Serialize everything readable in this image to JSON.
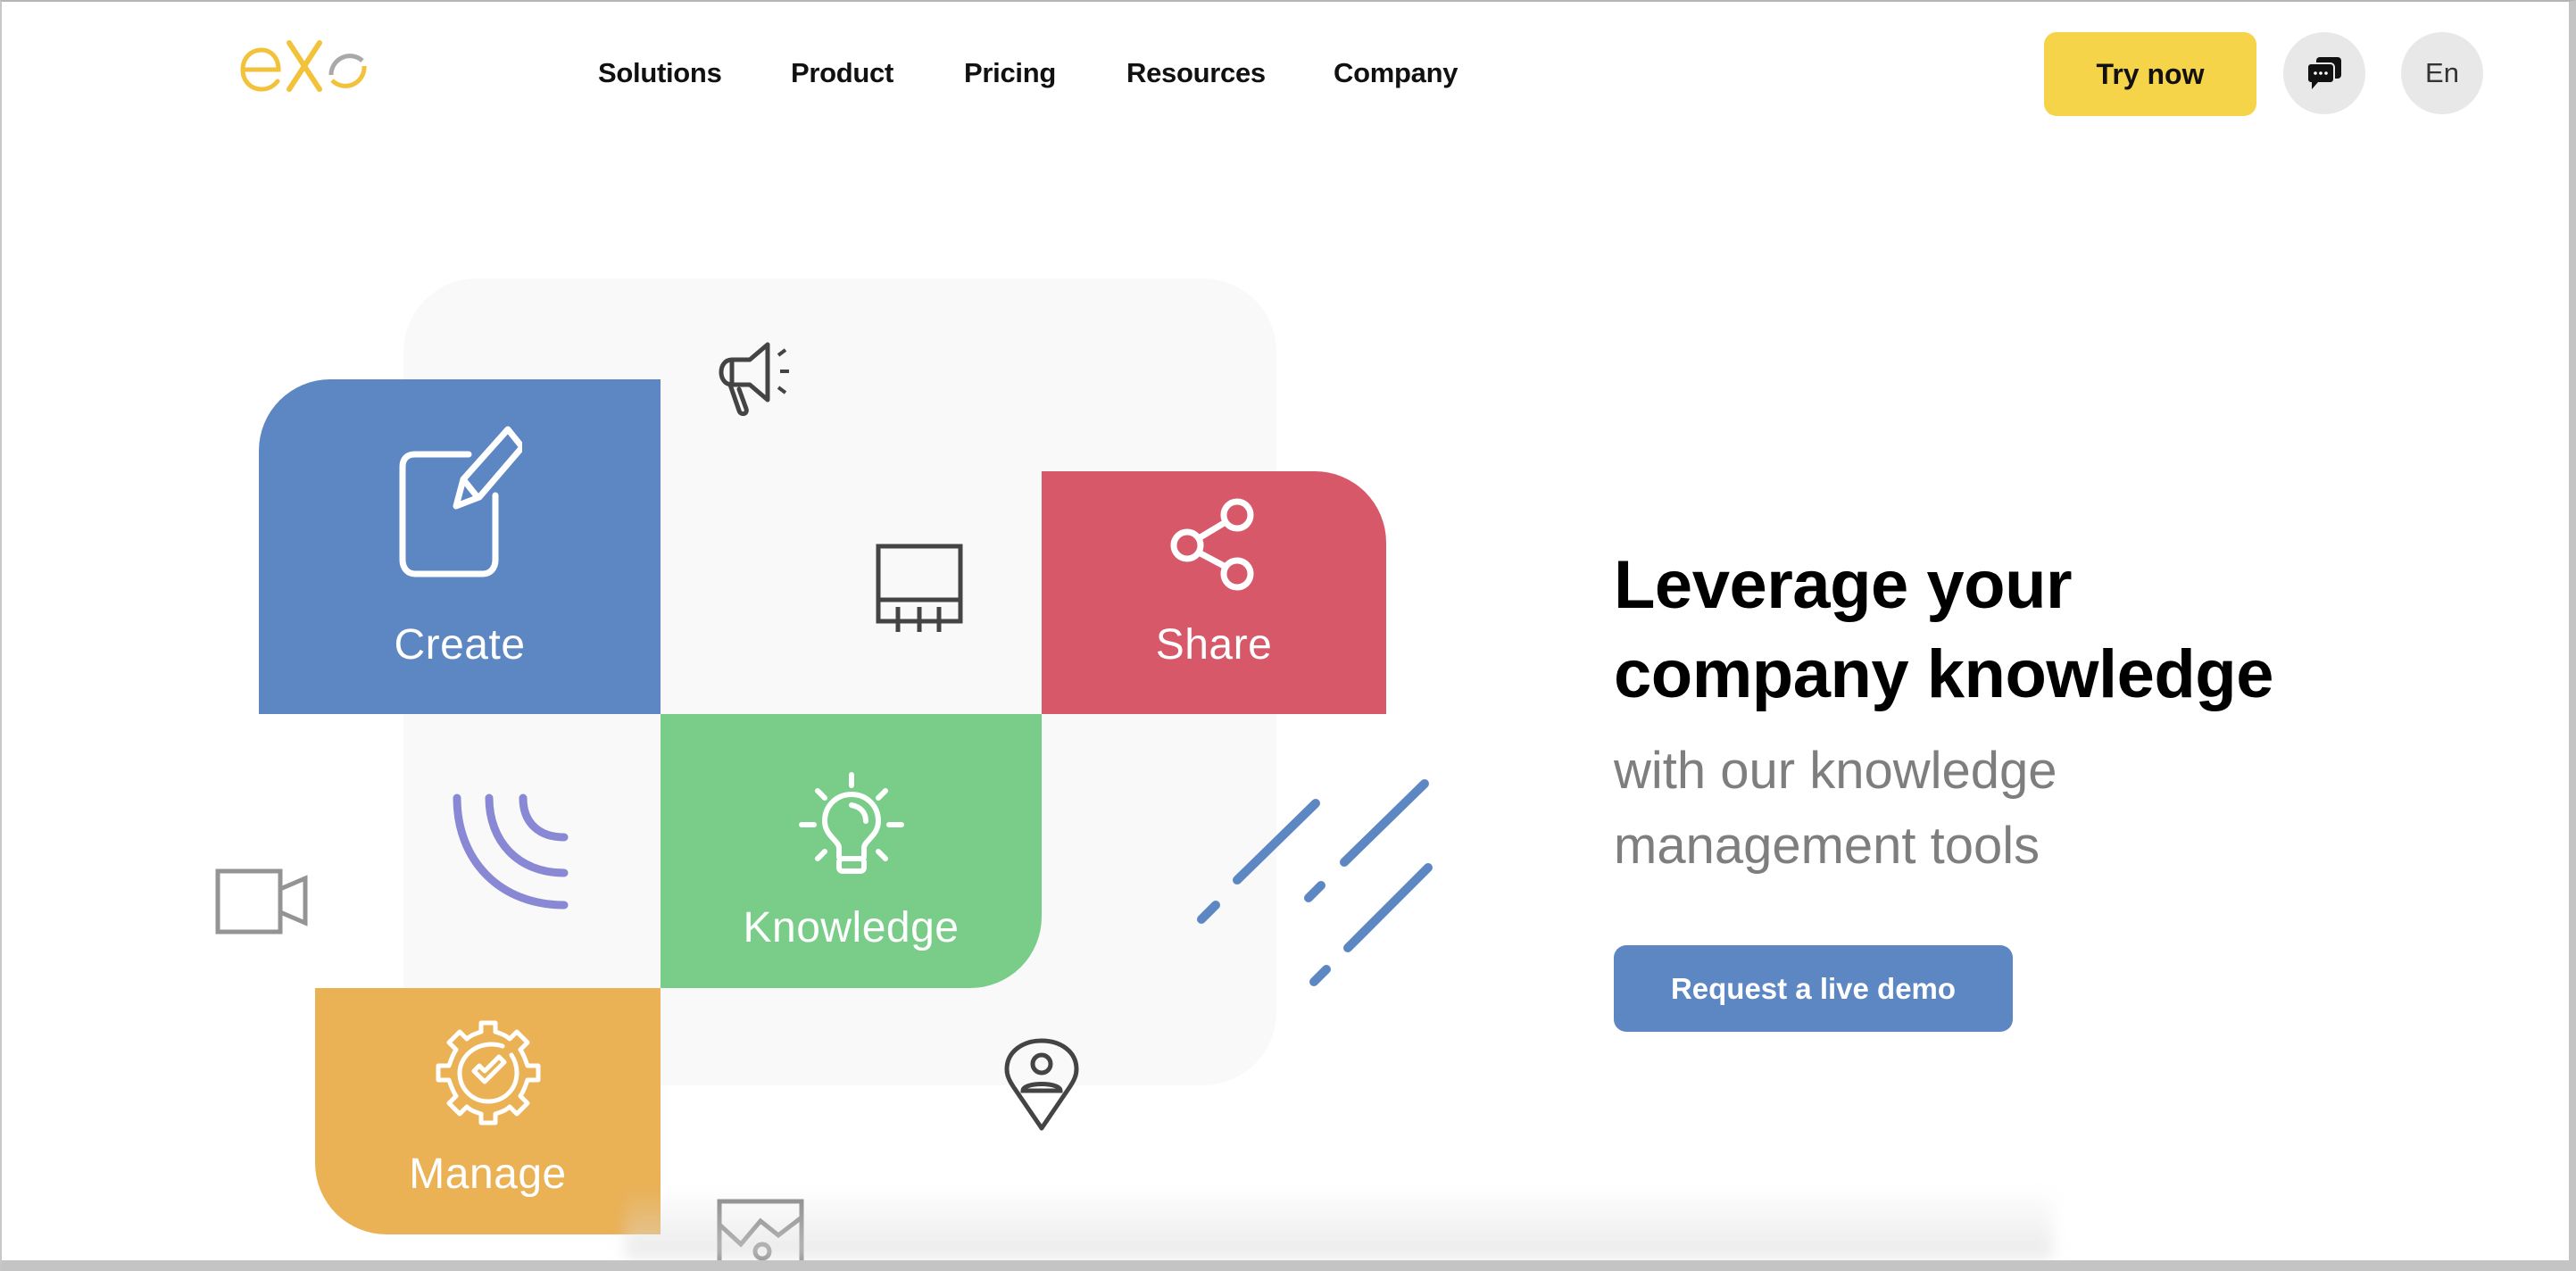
{
  "header": {
    "logo": {
      "text": "eXo",
      "brand_yellow": "#f2c23a",
      "brand_gray": "#a9a9a9"
    },
    "nav": [
      {
        "label": "Solutions"
      },
      {
        "label": "Product"
      },
      {
        "label": "Pricing"
      },
      {
        "label": "Resources"
      },
      {
        "label": "Company"
      }
    ],
    "try_now_label": "Try now",
    "chat_icon": "chat-bubbles-icon",
    "language_label": "En"
  },
  "illustration": {
    "tiles": [
      {
        "label": "Create",
        "icon": "edit-pencil-icon",
        "color": "#5d87c3"
      },
      {
        "label": "Share",
        "icon": "share-icon",
        "color": "#d75868"
      },
      {
        "label": "Knowledge",
        "icon": "lightbulb-icon",
        "color": "#79cd88"
      },
      {
        "label": "Manage",
        "icon": "gear-check-icon",
        "color": "#eab155"
      }
    ],
    "decorations": [
      "megaphone-icon",
      "presentation-board-icon",
      "signal-arcs-icon",
      "video-camera-icon",
      "diagonal-lines-decoration",
      "location-person-icon",
      "image-icon"
    ]
  },
  "hero": {
    "headline_line1": "Leverage your",
    "headline_line2": "company knowledge",
    "subline_line1": "with our knowledge",
    "subline_line2": "management tools",
    "cta_label": "Request a live demo",
    "accent_color": "#5d87c3"
  }
}
